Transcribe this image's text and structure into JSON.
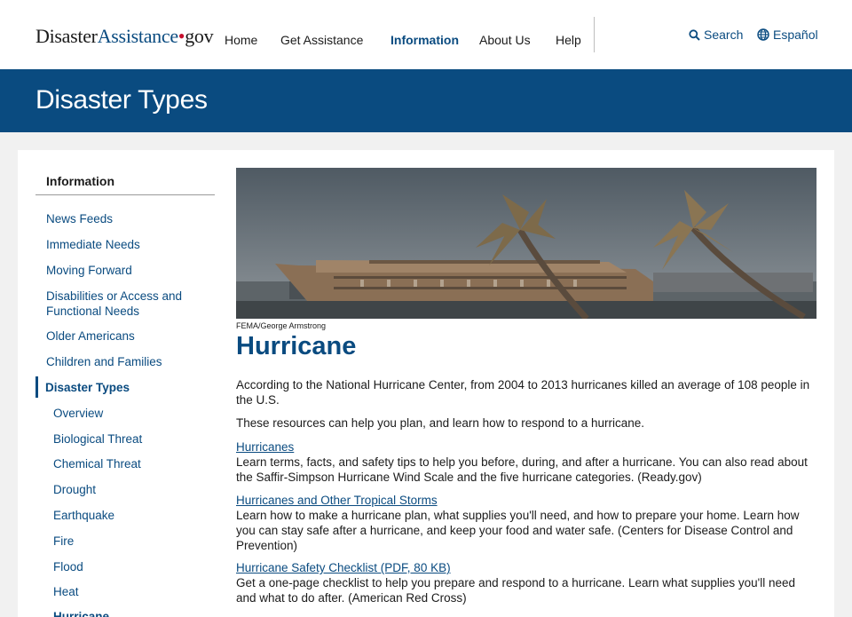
{
  "header": {
    "logo": {
      "part1": "Disaster",
      "part2": "Assistance",
      "dot": "•",
      "part3": "gov"
    },
    "nav": [
      "Home",
      "Get Assistance",
      "Information",
      "About Us",
      "Help"
    ],
    "active_nav": "Information",
    "search_label": "Search",
    "language_label": "Español",
    "colors": {
      "brand": "#0a4b80",
      "accent_dot": "#c8102e"
    }
  },
  "banner": {
    "title": "Disaster Types"
  },
  "sidebar": {
    "heading": "Information",
    "items": [
      "News Feeds",
      "Immediate Needs",
      "Moving Forward",
      "Disabilities or Access and Functional Needs",
      "Older Americans",
      "Children and Families"
    ],
    "current_section": "Disaster Types",
    "sub_items": [
      "Overview",
      "Biological Threat",
      "Chemical Threat",
      "Drought",
      "Earthquake",
      "Fire",
      "Flood",
      "Heat",
      "Hurricane"
    ]
  },
  "main": {
    "photo_credit": "FEMA/George Armstrong",
    "title": "Hurricane",
    "intro": "According to the National Hurricane Center, from 2004 to 2013 hurricanes killed an average of 108 people in the U.S.",
    "lead": "These resources can help you plan, and learn how to respond to a hurricane.",
    "resources": [
      {
        "link": "Hurricanes",
        "desc": "Learn terms, facts, and safety tips to help you before, during, and after a hurricane. You can also read about the Saffir-Simpson Hurricane Wind Scale and the five hurricane categories. (Ready.gov)"
      },
      {
        "link": "Hurricanes and Other Tropical Storms",
        "desc": "Learn how to make a hurricane plan, what supplies you'll need, and how to prepare your home. Learn how you can stay safe after a hurricane, and keep your food and water safe. (Centers for Disease Control and Prevention)"
      },
      {
        "link": "Hurricane Safety Checklist (PDF, 80 KB)",
        "desc": "Get a one-page checklist to help you prepare and respond to a hurricane. Learn what supplies you'll need and what to do after. (American Red Cross)"
      }
    ]
  }
}
